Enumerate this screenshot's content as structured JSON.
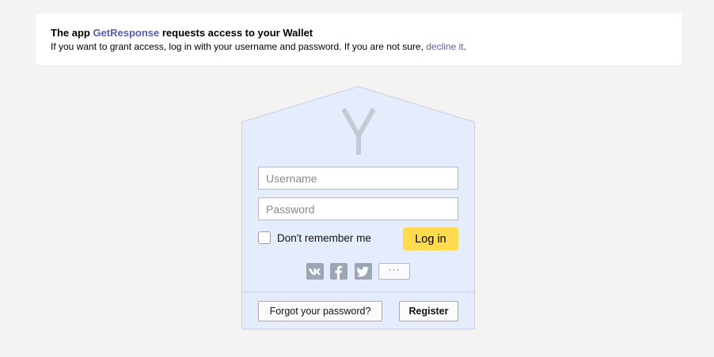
{
  "notice": {
    "title_prefix": "The app ",
    "app_name": "GetResponse",
    "title_suffix": " requests access to your Wallet",
    "text_prefix": "If you want to grant access, log in with your username and password. If you are not sure, ",
    "decline_link": "decline it",
    "text_suffix": "."
  },
  "login": {
    "logo_letter": "Y",
    "username_placeholder": "Username",
    "password_placeholder": "Password",
    "remember_label": "Don't remember me",
    "login_button": "Log in",
    "social": {
      "icons": [
        "vk-icon",
        "facebook-icon",
        "twitter-icon"
      ],
      "more_label": "···"
    },
    "forgot_button": "Forgot your password?",
    "register_button": "Register"
  },
  "colors": {
    "page_bg": "#f4f3f1",
    "card_bg": "#e5ecfc",
    "card_border": "#c7cfe6",
    "login_button": "#ffdb4d",
    "link": "#5b5bae",
    "social_icon": "#9da6b3"
  }
}
